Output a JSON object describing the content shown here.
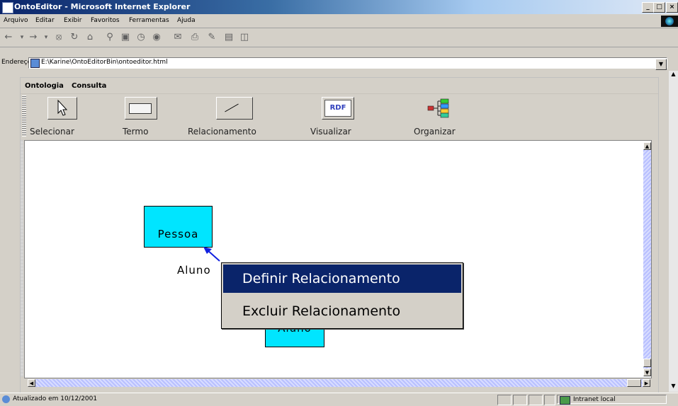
{
  "window": {
    "title": "OntoEditor - Microsoft Internet Explorer",
    "buttons": [
      "_",
      "□",
      "×"
    ]
  },
  "ie_menu": [
    "Arquivo",
    "Editar",
    "Exibir",
    "Favoritos",
    "Ferramentas",
    "Ajuda"
  ],
  "nav_toolbar": [
    "back-icon",
    "forward-icon",
    "stop-icon",
    "refresh-icon",
    "home-icon",
    "search-icon",
    "favorites-icon",
    "history-icon",
    "media-icon",
    "mail-icon",
    "print-icon",
    "edit-icon",
    "discuss-icon"
  ],
  "address": {
    "label": "Endereço",
    "url": "E:\\Karine\\OntoEditorBin\\ontoeditor.html"
  },
  "applet": {
    "menu": [
      "Ontologia",
      "Consulta"
    ],
    "tools": [
      {
        "label": "Selecionar",
        "icon": "cursor-arrow-icon"
      },
      {
        "label": "Termo",
        "icon": "rectangle-icon"
      },
      {
        "label": "Relacionamento",
        "icon": "line-icon"
      },
      {
        "label": "Visualizar",
        "icon": "rdf-icon",
        "icon_text": "RDF"
      },
      {
        "label": "Organizar",
        "icon": "hierarchy-icon"
      }
    ],
    "canvas": {
      "terms": [
        "Pessoa",
        "Aluno"
      ],
      "relationship_label": "Aluno",
      "term_color": "#00e5ff"
    },
    "context_menu": [
      "Definir Relacionamento",
      "Excluir Relacionamento"
    ]
  },
  "status": {
    "text": "Atualizado em 10/12/2001",
    "zone": "Intranet local"
  },
  "colors": {
    "selection": "#0a246a",
    "chrome": "#d4d0c8",
    "arrow": "#1020e0"
  }
}
